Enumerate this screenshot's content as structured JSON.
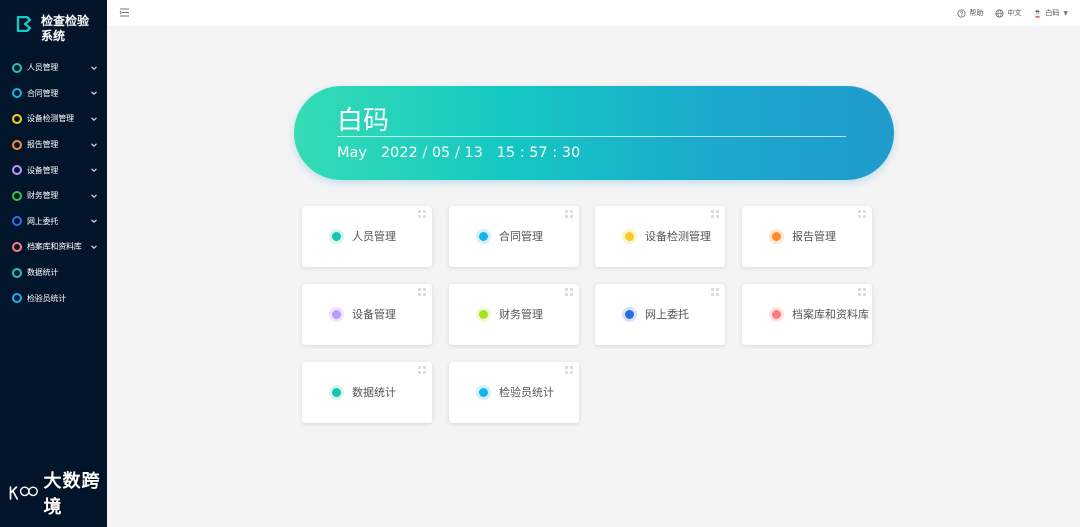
{
  "sidebar": {
    "title": "检查检验系统",
    "items": [
      {
        "label": "人员管理",
        "color": "#1bc8b4",
        "chevron": true
      },
      {
        "label": "合同管理",
        "color": "#14b4ec",
        "chevron": true
      },
      {
        "label": "设备检测管理",
        "color": "#f7d21e",
        "chevron": true
      },
      {
        "label": "报告管理",
        "color": "#ff8b36",
        "chevron": true
      },
      {
        "label": "设备管理",
        "color": "#b59bff",
        "chevron": true
      },
      {
        "label": "财务管理",
        "color": "#2cc84a",
        "chevron": true
      },
      {
        "label": "网上委托",
        "color": "#2c6fe8",
        "chevron": true
      },
      {
        "label": "档案库和资料库",
        "color": "#ff7d7d",
        "chevron": true
      },
      {
        "label": "数据统计",
        "color": "#1bc8b4",
        "chevron": false
      },
      {
        "label": "检验员统计",
        "color": "#14b4ec",
        "chevron": false
      }
    ],
    "watermark": "大数跨境"
  },
  "header": {
    "help": "帮助",
    "language": "中文",
    "user": "白码"
  },
  "banner": {
    "name": "白码",
    "month": "May",
    "date": "2022 / 05 / 13",
    "time": "15 : 57 : 30"
  },
  "cards": [
    {
      "label": "人员管理",
      "color": "#12c6b0",
      "halo": "#d6f5f1"
    },
    {
      "label": "合同管理",
      "color": "#14b4ec",
      "halo": "#d5eff9"
    },
    {
      "label": "设备检测管理",
      "color": "#f7c92a",
      "halo": "#fdf2cf"
    },
    {
      "label": "报告管理",
      "color": "#ff8a2e",
      "halo": "#ffe4d0"
    },
    {
      "label": "设备管理",
      "color": "#b79cff",
      "halo": "#eee6ff"
    },
    {
      "label": "财务管理",
      "color": "#a7e21c",
      "halo": "#eef9d3"
    },
    {
      "label": "网上委托",
      "color": "#2a6ce8",
      "halo": "#d6e3fa"
    },
    {
      "label": "档案库和资料库",
      "color": "#ff7b7b",
      "halo": "#ffe1e1"
    },
    {
      "label": "数据统计",
      "color": "#12c6b0",
      "halo": "#d6f5f1"
    },
    {
      "label": "检验员统计",
      "color": "#14b4ec",
      "halo": "#d5eff9"
    }
  ]
}
